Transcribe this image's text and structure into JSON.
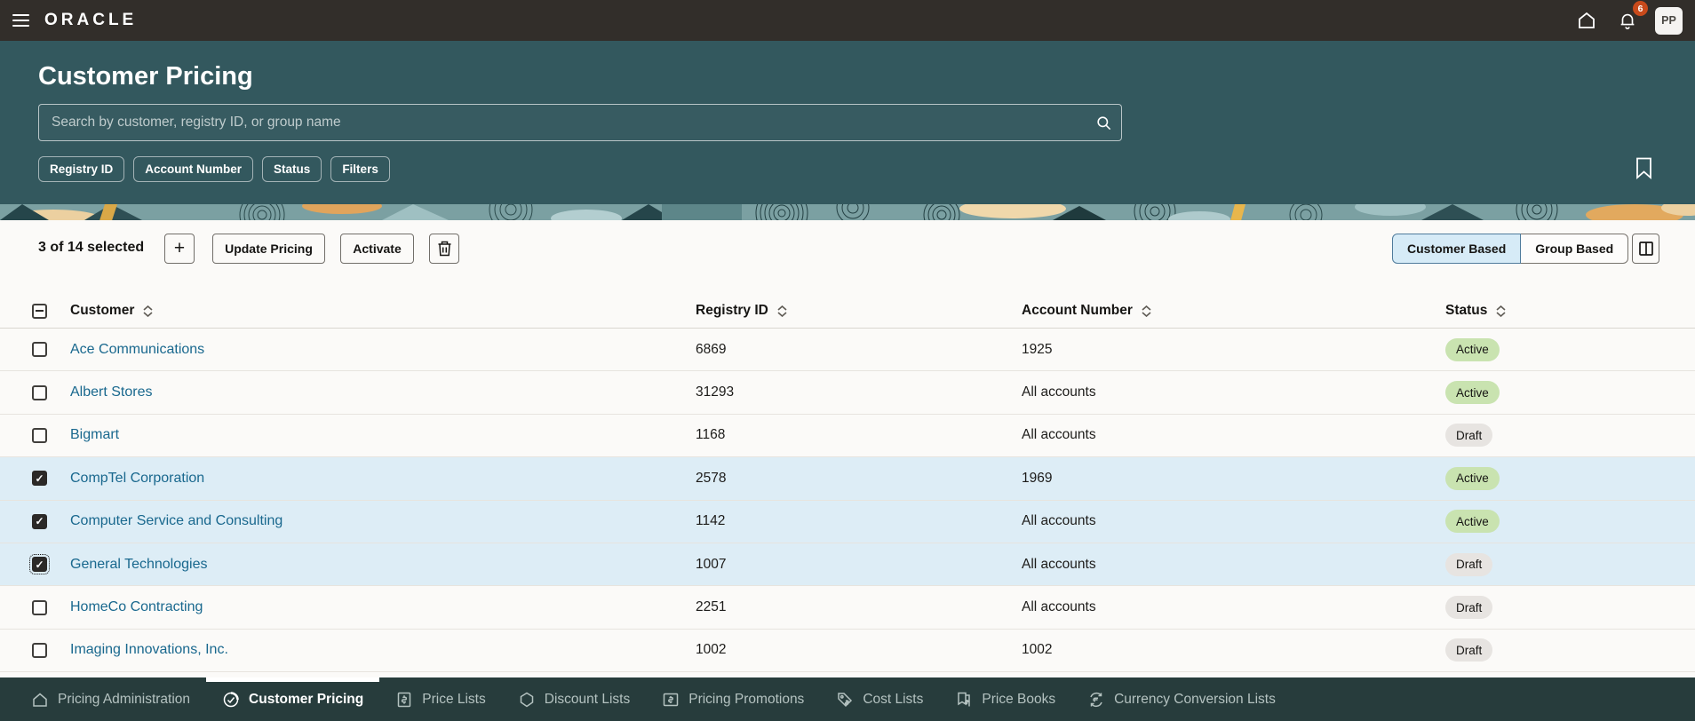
{
  "topbar": {
    "brand": "ORACLE",
    "notification_count": "6",
    "avatar_initials": "PP",
    "icons": [
      "hamburger-icon",
      "home-icon",
      "bell-icon",
      "avatar"
    ]
  },
  "hero": {
    "title": "Customer Pricing",
    "search_placeholder": "Search by customer, registry ID, or group name",
    "search_value": "",
    "chips": [
      "Registry ID",
      "Account Number",
      "Status",
      "Filters"
    ],
    "icons": [
      "search-icon",
      "bookmark-icon"
    ]
  },
  "toolbar": {
    "selection_summary": "3 of 14 selected",
    "add_label": "+",
    "update_pricing_label": "Update Pricing",
    "activate_label": "Activate",
    "icons": [
      "add-icon",
      "trash-icon",
      "split-panel-icon"
    ],
    "view_toggle": {
      "options": [
        "Customer Based",
        "Group Based"
      ],
      "selected": "Customer Based"
    }
  },
  "table": {
    "columns": [
      "Customer",
      "Registry ID",
      "Account Number",
      "Status"
    ],
    "header_checkbox_state": "indeterminate",
    "rows": [
      {
        "customer": "Ace Communications",
        "registry_id": "6869",
        "account_number": "1925",
        "status": "Active",
        "selected": false,
        "focused": false
      },
      {
        "customer": "Albert Stores",
        "registry_id": "31293",
        "account_number": "All accounts",
        "status": "Active",
        "selected": false,
        "focused": false
      },
      {
        "customer": "Bigmart",
        "registry_id": "1168",
        "account_number": "All accounts",
        "status": "Draft",
        "selected": false,
        "focused": false
      },
      {
        "customer": "CompTel Corporation",
        "registry_id": "2578",
        "account_number": "1969",
        "status": "Active",
        "selected": true,
        "focused": false
      },
      {
        "customer": "Computer Service and Consulting",
        "registry_id": "1142",
        "account_number": "All accounts",
        "status": "Active",
        "selected": true,
        "focused": false
      },
      {
        "customer": "General Technologies",
        "registry_id": "1007",
        "account_number": "All accounts",
        "status": "Draft",
        "selected": true,
        "focused": true
      },
      {
        "customer": "HomeCo Contracting",
        "registry_id": "2251",
        "account_number": "All accounts",
        "status": "Draft",
        "selected": false,
        "focused": false
      },
      {
        "customer": "Imaging Innovations, Inc.",
        "registry_id": "1002",
        "account_number": "1002",
        "status": "Draft",
        "selected": false,
        "focused": false
      }
    ]
  },
  "bottom_nav": {
    "items": [
      {
        "label": "Pricing Administration",
        "icon": "home-icon",
        "active": false
      },
      {
        "label": "Customer Pricing",
        "icon": "customer-pricing-icon",
        "active": true
      },
      {
        "label": "Price Lists",
        "icon": "price-list-icon",
        "active": false
      },
      {
        "label": "Discount Lists",
        "icon": "discount-tag-icon",
        "active": false
      },
      {
        "label": "Pricing Promotions",
        "icon": "promotion-icon",
        "active": false
      },
      {
        "label": "Cost Lists",
        "icon": "cost-tag-icon",
        "active": false
      },
      {
        "label": "Price Books",
        "icon": "price-book-icon",
        "active": false
      },
      {
        "label": "Currency Conversion Lists",
        "icon": "currency-conversion-icon",
        "active": false
      }
    ]
  },
  "colors": {
    "topbar_bg": "#322e2a",
    "hero_teal": "#33585e",
    "nav_teal": "#273c3c",
    "page_bg": "#fbfaf8",
    "link_blue": "#19688e",
    "selected_row_bg": "#ddedf6",
    "badge_active_bg": "#c9e3b0",
    "badge_draft_bg": "#e7e4e1",
    "notification_badge": "#c84a1b",
    "toggle_selected_bg": "#d6ebf7"
  }
}
